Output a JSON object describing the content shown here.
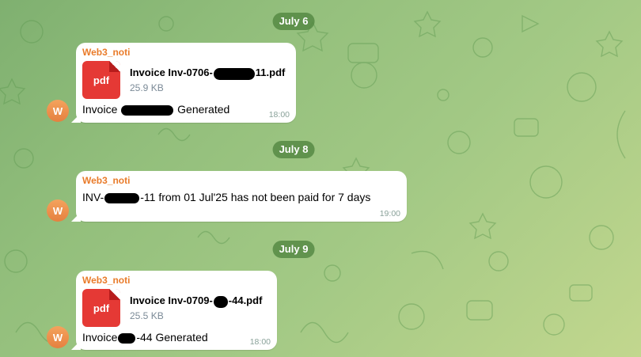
{
  "chat": {
    "background_color": "#93bf7c",
    "avatar_initial": "W",
    "dates": [
      "July 6",
      "July 8",
      "July 9"
    ],
    "messages": [
      {
        "sender": "Web3_noti",
        "file_name_start": "Invoice Inv-0706-",
        "file_name_end": "11.pdf",
        "file_size": "25.9 KB",
        "file_icon_label": "pdf",
        "text_start": "Invoice ",
        "text_end": "Generated",
        "time": "18:00"
      },
      {
        "sender": "Web3_noti",
        "text_start": "INV-",
        "text_end": "-11 from 01 Jul'25 has not been paid for 7 days",
        "time": "19:00"
      },
      {
        "sender": "Web3_noti",
        "file_name_start": "Invoice Inv-0709-",
        "file_name_end": "-44.pdf",
        "file_size": "25.5 KB",
        "file_icon_label": "pdf",
        "text_start": "Invoice",
        "text_end": "-44 Generated",
        "time": "18:00"
      }
    ]
  },
  "colors": {
    "sender_name": "#e97b2a",
    "pdf_icon": "#e53935",
    "avatar": "#f4a35d",
    "date_pill": "#568a44"
  }
}
